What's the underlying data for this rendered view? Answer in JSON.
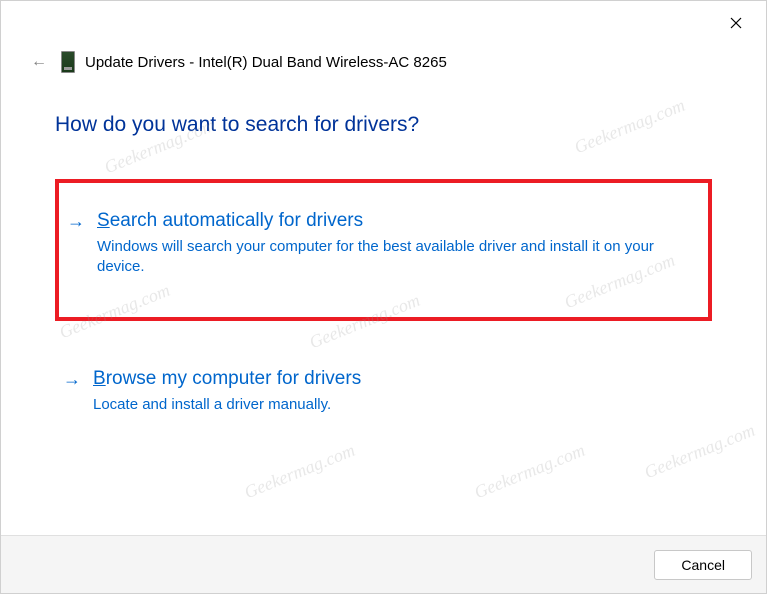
{
  "header": {
    "title": "Update Drivers - Intel(R) Dual Band Wireless-AC 8265"
  },
  "question": "How do you want to search for drivers?",
  "options": [
    {
      "title_prefix": "S",
      "title_rest": "earch automatically for drivers",
      "description": "Windows will search your computer for the best available driver and install it on your device.",
      "highlighted": true
    },
    {
      "title_prefix": "B",
      "title_rest": "rowse my computer for drivers",
      "description": "Locate and install a driver manually.",
      "highlighted": false
    }
  ],
  "footer": {
    "cancel_label": "Cancel"
  },
  "watermark": "Geekermag.com"
}
